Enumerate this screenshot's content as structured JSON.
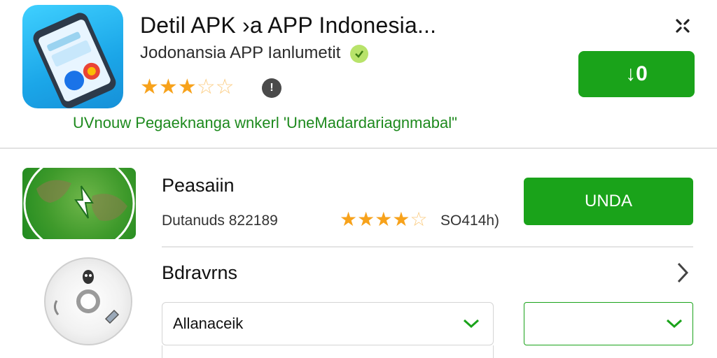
{
  "header": {
    "app_icon": "phone-app-icon",
    "title": "Detil APK ›a APP Indonesia...",
    "subtitle": "Jodonansia APP Ianlumetit",
    "verified_icon": "verified-badge-icon",
    "rating": 3.5,
    "info_icon": "info-icon",
    "close_icon": "close-icon",
    "download_label": "↓0",
    "note": "UVnouw Pegaeknanga wnkerl 'UneMadardariagnmabal\""
  },
  "items": [
    {
      "icon": "globe-icon",
      "title": "Peasaiin",
      "downloads": "Dutanuds 822189",
      "rating": 4.5,
      "size": "SO414h)",
      "button_label": "UNDA"
    },
    {
      "icon": "disc-icon",
      "title": "Bdravrns",
      "chevron_icon": "chevron-right-icon",
      "select_value": "Allanaceik",
      "check_icon": "check-icon"
    }
  ],
  "colors": {
    "accent_green": "#1aa31a",
    "star_orange": "#f7a21b",
    "app_icon_blue": "#1ba6e8"
  }
}
